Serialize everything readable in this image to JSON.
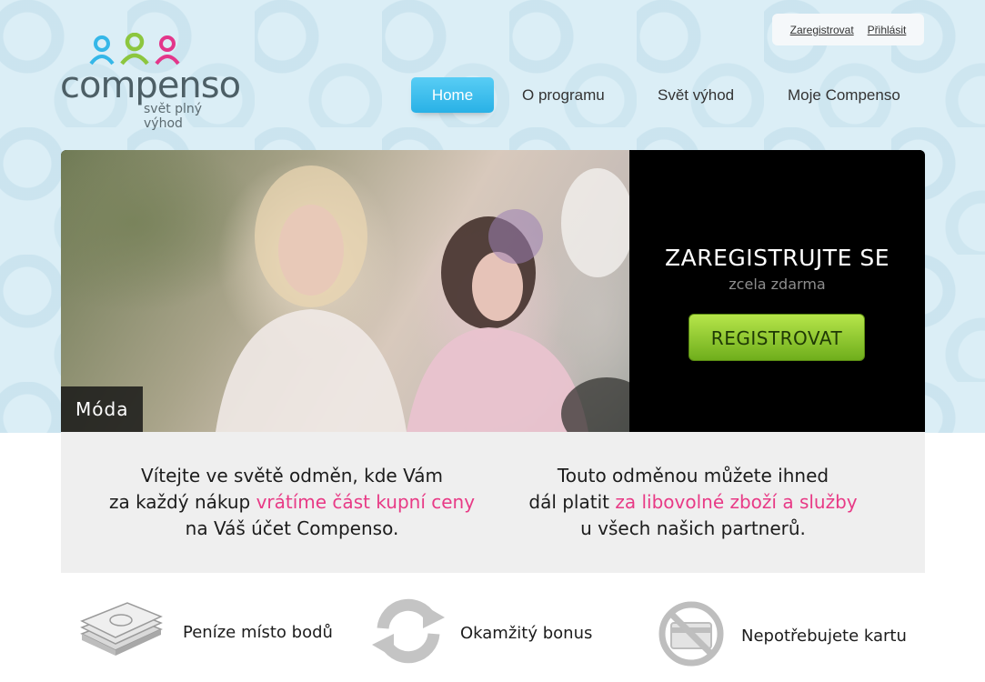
{
  "header": {
    "logo": {
      "word": "compenso",
      "tagline": "svět plný výhod"
    },
    "top_links": {
      "register": "Zaregistrovat",
      "login": "Přihlásit"
    },
    "nav": [
      "Home",
      "O programu",
      "Svět výhod",
      "Moje Compenso"
    ]
  },
  "hero": {
    "caption": "Móda",
    "title": "ZAREGISTRUJTE SE",
    "subtitle": "zcela zdarma",
    "button": "REGISTROVAT"
  },
  "intro": {
    "left": {
      "line1": "Vítejte ve světě odměn, kde Vám",
      "line2_prefix": "za každý nákup ",
      "line2_highlight": "vrátíme část kupní ceny",
      "line3": "na Váš účet Compenso."
    },
    "right": {
      "line1": "Touto odměnou můžete ihned",
      "line2_prefix": "dál platit ",
      "line2_highlight": "za libovolné zboží a služby",
      "line3": "u všech našich partnerů."
    }
  },
  "features": [
    {
      "label": "Peníze místo bodů",
      "icon": "money-stack-icon"
    },
    {
      "label": "Okamžitý bonus",
      "icon": "refresh-arrows-icon"
    },
    {
      "label": "Nepotřebujete kartu",
      "icon": "no-card-icon"
    }
  ],
  "colors": {
    "accent_blue": "#29b1e6",
    "accent_pink": "#e83a86",
    "accent_green": "#8cc63f",
    "logo_person_blue": "#35b7e8",
    "logo_person_green": "#8cc63f",
    "logo_person_pink": "#e3368a"
  }
}
